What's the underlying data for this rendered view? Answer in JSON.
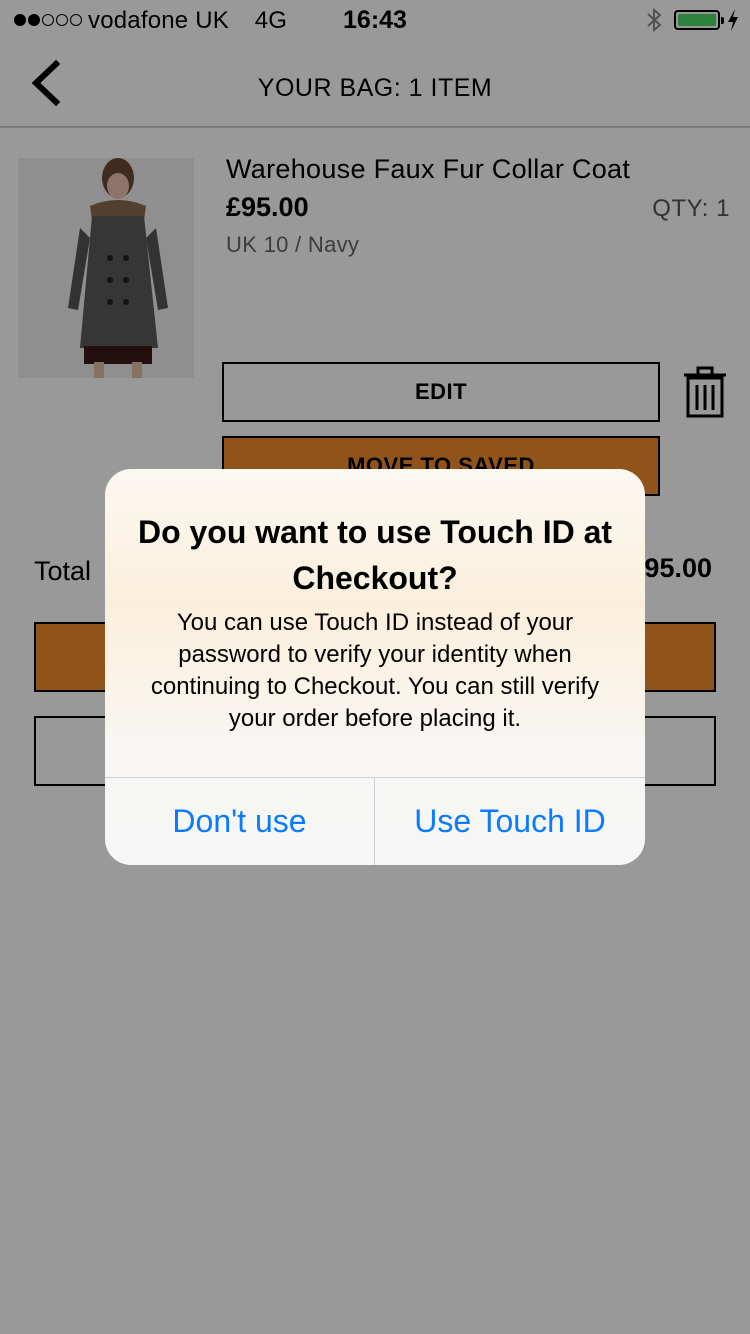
{
  "status_bar": {
    "carrier": "vodafone UK",
    "network": "4G",
    "time": "16:43",
    "signal_bars_filled": 2,
    "signal_bars_total": 5,
    "battery_color": "#4cd964"
  },
  "nav": {
    "title": "YOUR BAG: 1 ITEM",
    "back_icon": "chevron-left-icon"
  },
  "product": {
    "name": "Warehouse Faux Fur Collar Coat",
    "price": "£95.00",
    "qty": "QTY: 1",
    "variant": "UK 10 / Navy",
    "edit_label": "EDIT",
    "move_label": "MOVE TO SAVED",
    "delete_icon": "trash-icon"
  },
  "summary": {
    "total_label": "Total",
    "total_value": "£95.00"
  },
  "colors": {
    "accent_orange": "#f08a2c",
    "alert_button_blue": "#0a7aff"
  },
  "alert": {
    "title": "Do you want to use Touch ID at Checkout?",
    "message": "You can use Touch ID instead of your password to verify your identity when continuing to Checkout. You can still verify your order before placing it.",
    "cancel_label": "Don't use",
    "confirm_label": "Use Touch ID"
  }
}
